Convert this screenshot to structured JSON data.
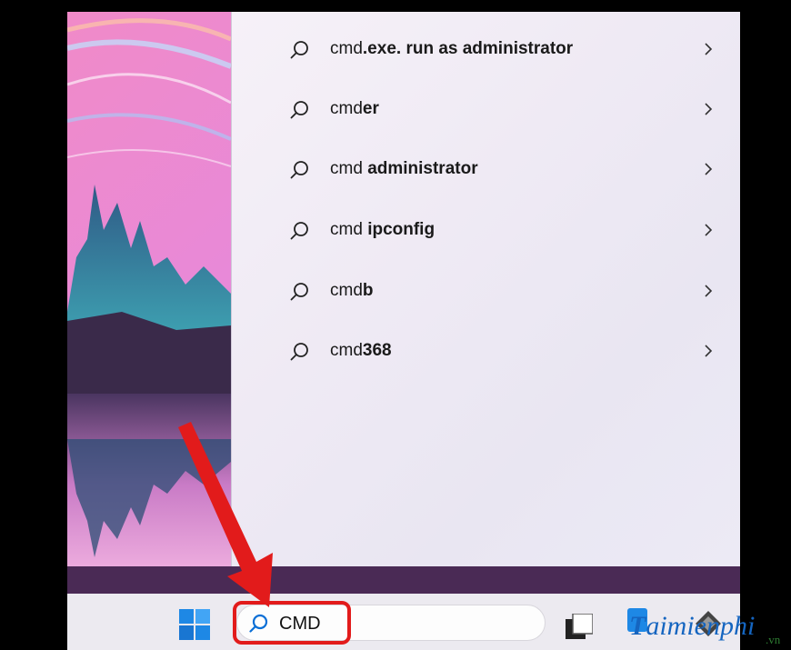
{
  "search_results": [
    {
      "prefix": "cmd",
      "suffix": ".exe. run as administrator"
    },
    {
      "prefix": "cmd",
      "suffix": "er"
    },
    {
      "prefix": "cmd ",
      "suffix": "administrator"
    },
    {
      "prefix": "cmd ",
      "suffix": "ipconfig"
    },
    {
      "prefix": "cmd",
      "suffix": "b"
    },
    {
      "prefix": "cmd",
      "suffix": "368"
    }
  ],
  "taskbar": {
    "search_value": "CMD",
    "icons": [
      "windows-start-icon",
      "search-icon",
      "task-view-icon",
      "app-icon",
      "app-icon"
    ]
  },
  "colors": {
    "highlight": "#e21b1b",
    "accent": "#0a6fd6"
  },
  "watermark": {
    "text": "aimienphi",
    "tld": ".vn"
  }
}
